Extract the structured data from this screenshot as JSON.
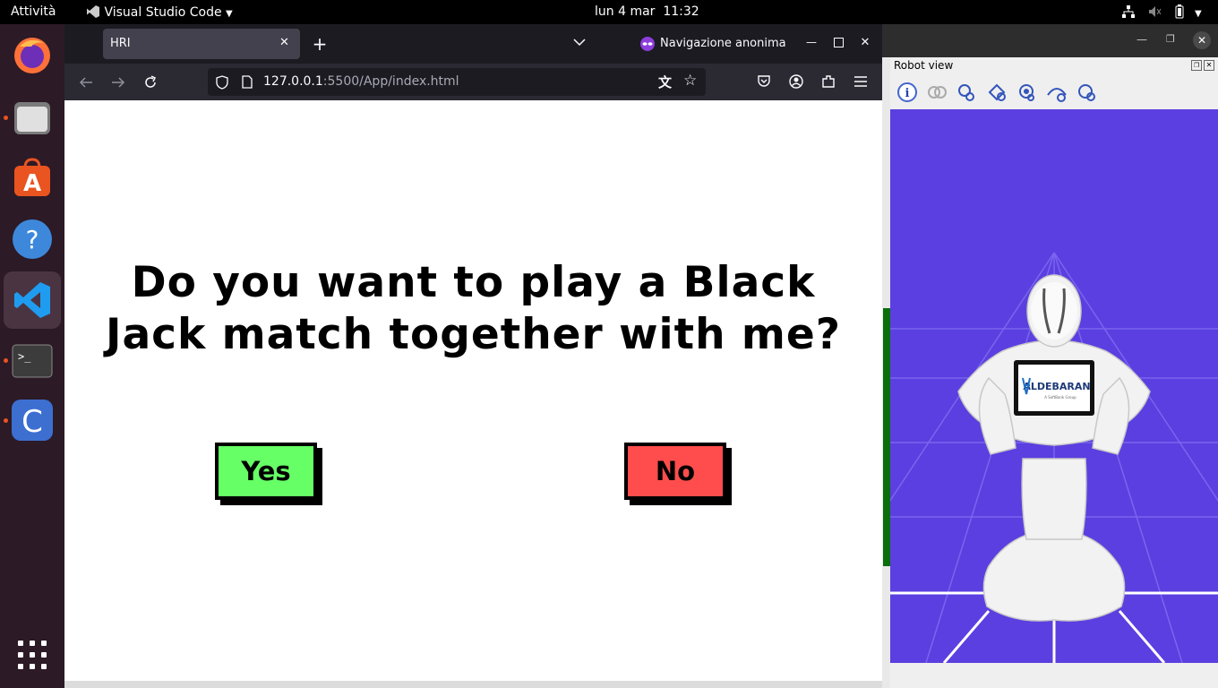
{
  "topbar": {
    "activities": "Attività",
    "app_name": "Visual Studio Code",
    "date": "lun 4 mar",
    "time": "11:32"
  },
  "dock": {
    "items": [
      "firefox",
      "files",
      "app-center",
      "help",
      "vscode",
      "terminal",
      "c-app"
    ]
  },
  "browser": {
    "tab_title": "HRI",
    "private_label": "Navigazione anonima",
    "url_host": "127.0.0.1",
    "url_rest": ":5500/App/index.html"
  },
  "page": {
    "question": "Do you want to play a Black Jack match together with me?",
    "yes_label": "Yes",
    "no_label": "No"
  },
  "robot_panel": {
    "title": "Robot view",
    "logo_text": "ALDEBARAN",
    "logo_sub": "A SoftBank Group"
  },
  "colors": {
    "yes": "#66ff66",
    "no": "#ff4d4d",
    "sky": "#5b3fe0"
  }
}
